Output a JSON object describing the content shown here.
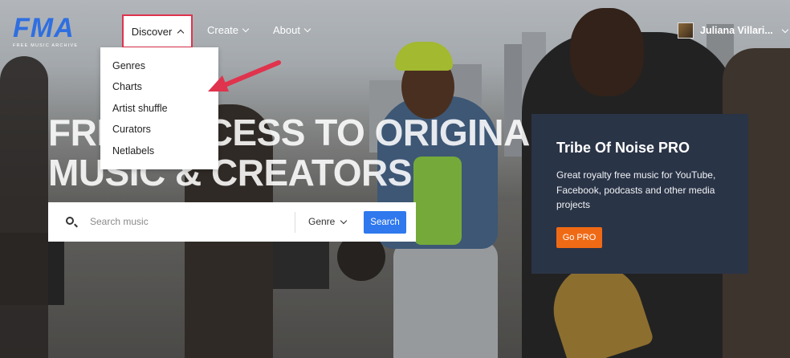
{
  "brand": {
    "logo_text": "FMA",
    "logo_subtitle": "FREE MUSIC ARCHIVE",
    "logo_color": "#2f6fe0"
  },
  "nav": {
    "discover_label": "Discover",
    "create_label": "Create",
    "about_label": "About"
  },
  "dropdown": {
    "items": [
      "Genres",
      "Charts",
      "Artist shuffle",
      "Curators",
      "Netlabels"
    ]
  },
  "user": {
    "name": "Juliana Villari..."
  },
  "hero": {
    "headline_line1": "FREE ACCESS TO ORIGINAL",
    "headline_line2": "MUSIC & CREATORS"
  },
  "search": {
    "placeholder": "Search music",
    "genre_label": "Genre",
    "button_label": "Search",
    "button_color": "#2f78ee"
  },
  "promo": {
    "title": "Tribe Of Noise PRO",
    "text": "Great royalty free music for YouTube, Facebook, podcasts and other media projects",
    "button_label": "Go PRO",
    "button_color": "#f06a15"
  },
  "annotation": {
    "highlight_color": "#e0334d"
  }
}
